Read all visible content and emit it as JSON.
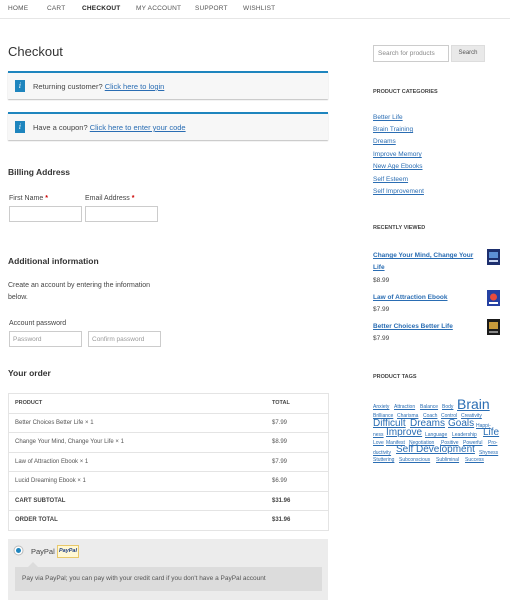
{
  "nav": {
    "items": [
      {
        "label": "HOME",
        "active": false
      },
      {
        "label": "CART",
        "active": false
      },
      {
        "label": "CHECKOUT",
        "active": true
      },
      {
        "label": "MY ACCOUNT",
        "active": false
      },
      {
        "label": "SUPPORT",
        "active": false
      },
      {
        "label": "WISHLIST",
        "active": false
      }
    ]
  },
  "page": {
    "title": "Checkout"
  },
  "notices": {
    "returning": {
      "text": "Returning customer?",
      "link": "Click here to login"
    },
    "coupon": {
      "text": "Have a coupon?",
      "link": "Click here to enter your code"
    }
  },
  "billing": {
    "heading": "Billing Address",
    "first_name_label": "First Name",
    "email_label": "Email Address",
    "required_marker": "*"
  },
  "additional": {
    "heading": "Additional information",
    "description": "Create an account by entering the information below.",
    "account_password_label": "Account password",
    "password_placeholder": "Password",
    "confirm_placeholder": "Confirm password"
  },
  "order": {
    "heading": "Your order",
    "col_product": "PRODUCT",
    "col_total": "TOTAL",
    "items": [
      {
        "name": "Better Choices Better Life",
        "qty": "× 1",
        "total": "$7.99"
      },
      {
        "name": "Change Your Mind, Change Your Life",
        "qty": "× 1",
        "total": "$8.99"
      },
      {
        "name": "Law of Attraction Ebook",
        "qty": "× 1",
        "total": "$7.99"
      },
      {
        "name": "Lucid Dreaming Ebook",
        "qty": "× 1",
        "total": "$6.99"
      }
    ],
    "subtotal_label": "CART SUBTOTAL",
    "subtotal": "$31.96",
    "total_label": "ORDER TOTAL",
    "total": "$31.96"
  },
  "payment": {
    "method": "PayPal",
    "logo_text": "PayPal",
    "description": "Pay via PayPal; you can pay with your credit card if you don't have a PayPal account"
  },
  "sidebar": {
    "search_placeholder": "Search for products",
    "search_button": "Search",
    "categories_heading": "PRODUCT CATEGORIES",
    "categories": [
      "Better Life",
      "Brain Training",
      "Dreams",
      "Improve Memory",
      "New Age Ebooks",
      "Self Esteem",
      "Self Improvement"
    ],
    "recent_heading": "RECENTLY VIEWED",
    "recent": [
      {
        "name": "Change Your Mind, Change Your Life",
        "price": "$8.99"
      },
      {
        "name": "Law of Attraction Ebook",
        "price": "$7.99"
      },
      {
        "name": "Better Choices Better Life",
        "price": "$7.99"
      }
    ],
    "tags_heading": "PRODUCT TAGS",
    "tags": [
      "Anxiety",
      "Attraction",
      "Balance",
      "Body",
      "Brain",
      "Brilliance",
      "Charisma",
      "Coach",
      "Control",
      "Creativity",
      "Difficult",
      "Dreams",
      "Goals",
      "Happi-",
      "ness",
      "Improve",
      "Language",
      "Leadership",
      "Life",
      "Love",
      "Manifest",
      "Negotiation",
      "Positive",
      "Powerful",
      "Pro-",
      "ductivity",
      "Self Development",
      "Shyness",
      "Stuttering",
      "Subconscious",
      "Subliminal",
      "Success"
    ]
  }
}
